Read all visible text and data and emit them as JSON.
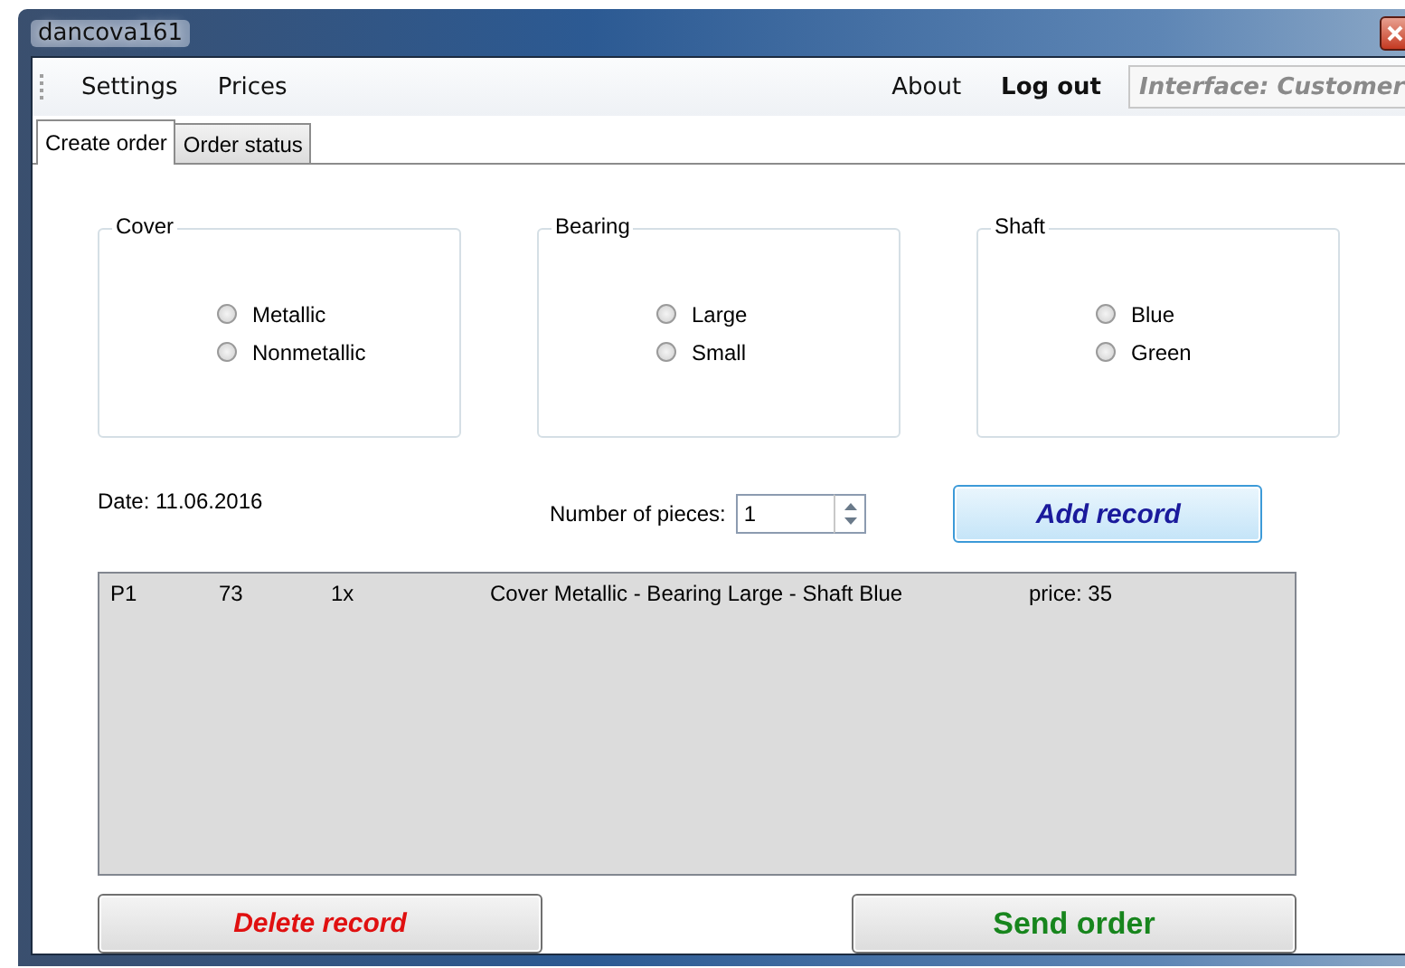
{
  "window": {
    "title": "dancova161"
  },
  "menu": {
    "left": [
      {
        "label": "Settings"
      },
      {
        "label": "Prices"
      }
    ],
    "right": [
      {
        "label": "About",
        "emphasized": false
      },
      {
        "label": "Log out",
        "emphasized": true
      }
    ],
    "interface_field": {
      "value": "Interface: Customer"
    }
  },
  "tabs": [
    {
      "label": "Create order",
      "selected": true
    },
    {
      "label": "Order status",
      "selected": false
    }
  ],
  "groups": [
    {
      "title": "Cover",
      "options": [
        {
          "label": "Metallic",
          "selected": false
        },
        {
          "label": "Nonmetallic",
          "selected": false
        }
      ]
    },
    {
      "title": "Bearing",
      "options": [
        {
          "label": "Large",
          "selected": false
        },
        {
          "label": "Small",
          "selected": false
        }
      ]
    },
    {
      "title": "Shaft",
      "options": [
        {
          "label": "Blue",
          "selected": false
        },
        {
          "label": "Green",
          "selected": false
        }
      ]
    }
  ],
  "date": "Date: 11.06.2016",
  "pieces": {
    "label": "Number of pieces:",
    "value": "1"
  },
  "add_button": {
    "label": "Add record",
    "kind": "add"
  },
  "records": [
    {
      "cells": [
        "P1",
        "73",
        "1x",
        "Cover Metallic - Bearing Large - Shaft Blue",
        "price: 35"
      ]
    }
  ],
  "bottom_buttons": [
    {
      "label": "Delete record",
      "kind": "delete"
    },
    {
      "label": "Send order",
      "kind": "send"
    }
  ]
}
